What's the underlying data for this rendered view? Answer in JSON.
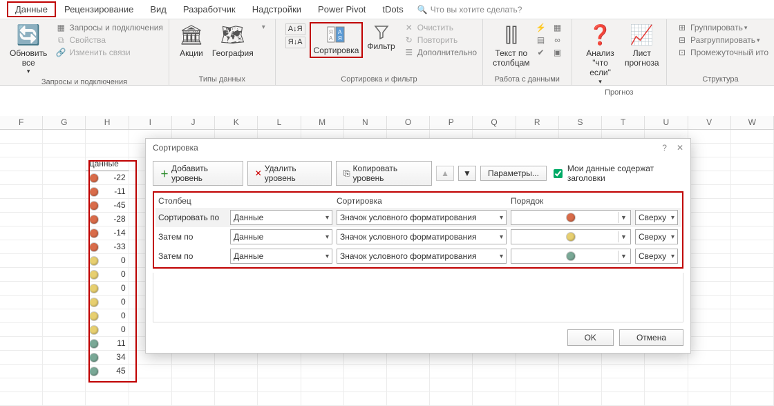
{
  "tabs": [
    "Данные",
    "Рецензирование",
    "Вид",
    "Разработчик",
    "Надстройки",
    "Power Pivot",
    "tDots"
  ],
  "tell_me_placeholder": "Что вы хотите сделать?",
  "ribbon": {
    "refresh": "Обновить все",
    "queries": "Запросы и подключения",
    "properties": "Свойства",
    "edit_links": "Изменить связи",
    "group1": "Запросы и подключения",
    "stocks": "Акции",
    "geography": "География",
    "group2": "Типы данных",
    "sort": "Сортировка",
    "filter": "Фильтр",
    "clear": "Очистить",
    "reapply": "Повторить",
    "advanced": "Дополнительно",
    "group3": "Сортировка и фильтр",
    "text_to_cols": "Текст по столбцам",
    "group4": "Работа с данными",
    "whatif": "Анализ \"что если\"",
    "forecast": "Лист прогноза",
    "group5": "Прогноз",
    "grp": "Группировать",
    "ungrp": "Разгруппировать",
    "subtotal": "Промежуточный ито",
    "group6": "Структура"
  },
  "columns": [
    "F",
    "G",
    "H",
    "I",
    "J",
    "K",
    "L",
    "M",
    "N",
    "O",
    "P",
    "Q",
    "R",
    "S",
    "T",
    "U",
    "V",
    "W"
  ],
  "data_header": "Данные",
  "data": [
    {
      "v": -22,
      "c": "#d96c4a"
    },
    {
      "v": -11,
      "c": "#d96c4a"
    },
    {
      "v": -45,
      "c": "#d96c4a"
    },
    {
      "v": -28,
      "c": "#d96c4a"
    },
    {
      "v": -14,
      "c": "#d96c4a"
    },
    {
      "v": -33,
      "c": "#d96c4a"
    },
    {
      "v": 0,
      "c": "#e7cf70"
    },
    {
      "v": 0,
      "c": "#e7cf70"
    },
    {
      "v": 0,
      "c": "#e7cf70"
    },
    {
      "v": 0,
      "c": "#e7cf70"
    },
    {
      "v": 0,
      "c": "#e7cf70"
    },
    {
      "v": 0,
      "c": "#e7cf70"
    },
    {
      "v": 11,
      "c": "#7aa896"
    },
    {
      "v": 34,
      "c": "#7aa896"
    },
    {
      "v": 45,
      "c": "#7aa896"
    }
  ],
  "dialog": {
    "title": "Сортировка",
    "add": "Добавить уровень",
    "del": "Удалить уровень",
    "copy": "Копировать уровень",
    "opts": "Параметры...",
    "my_data_headers": "Мои данные содержат заголовки",
    "col_h": "Столбец",
    "sort_h": "Сортировка",
    "order_h": "Порядок",
    "sort_by": "Сортировать по",
    "then_by": "Затем по",
    "field": "Данные",
    "sort_on": "Значок условного форматирования",
    "pos": "Сверху",
    "rows": [
      {
        "c": "#d96c4a"
      },
      {
        "c": "#e7cf70"
      },
      {
        "c": "#7aa896"
      }
    ],
    "ok": "OK",
    "cancel": "Отмена"
  }
}
